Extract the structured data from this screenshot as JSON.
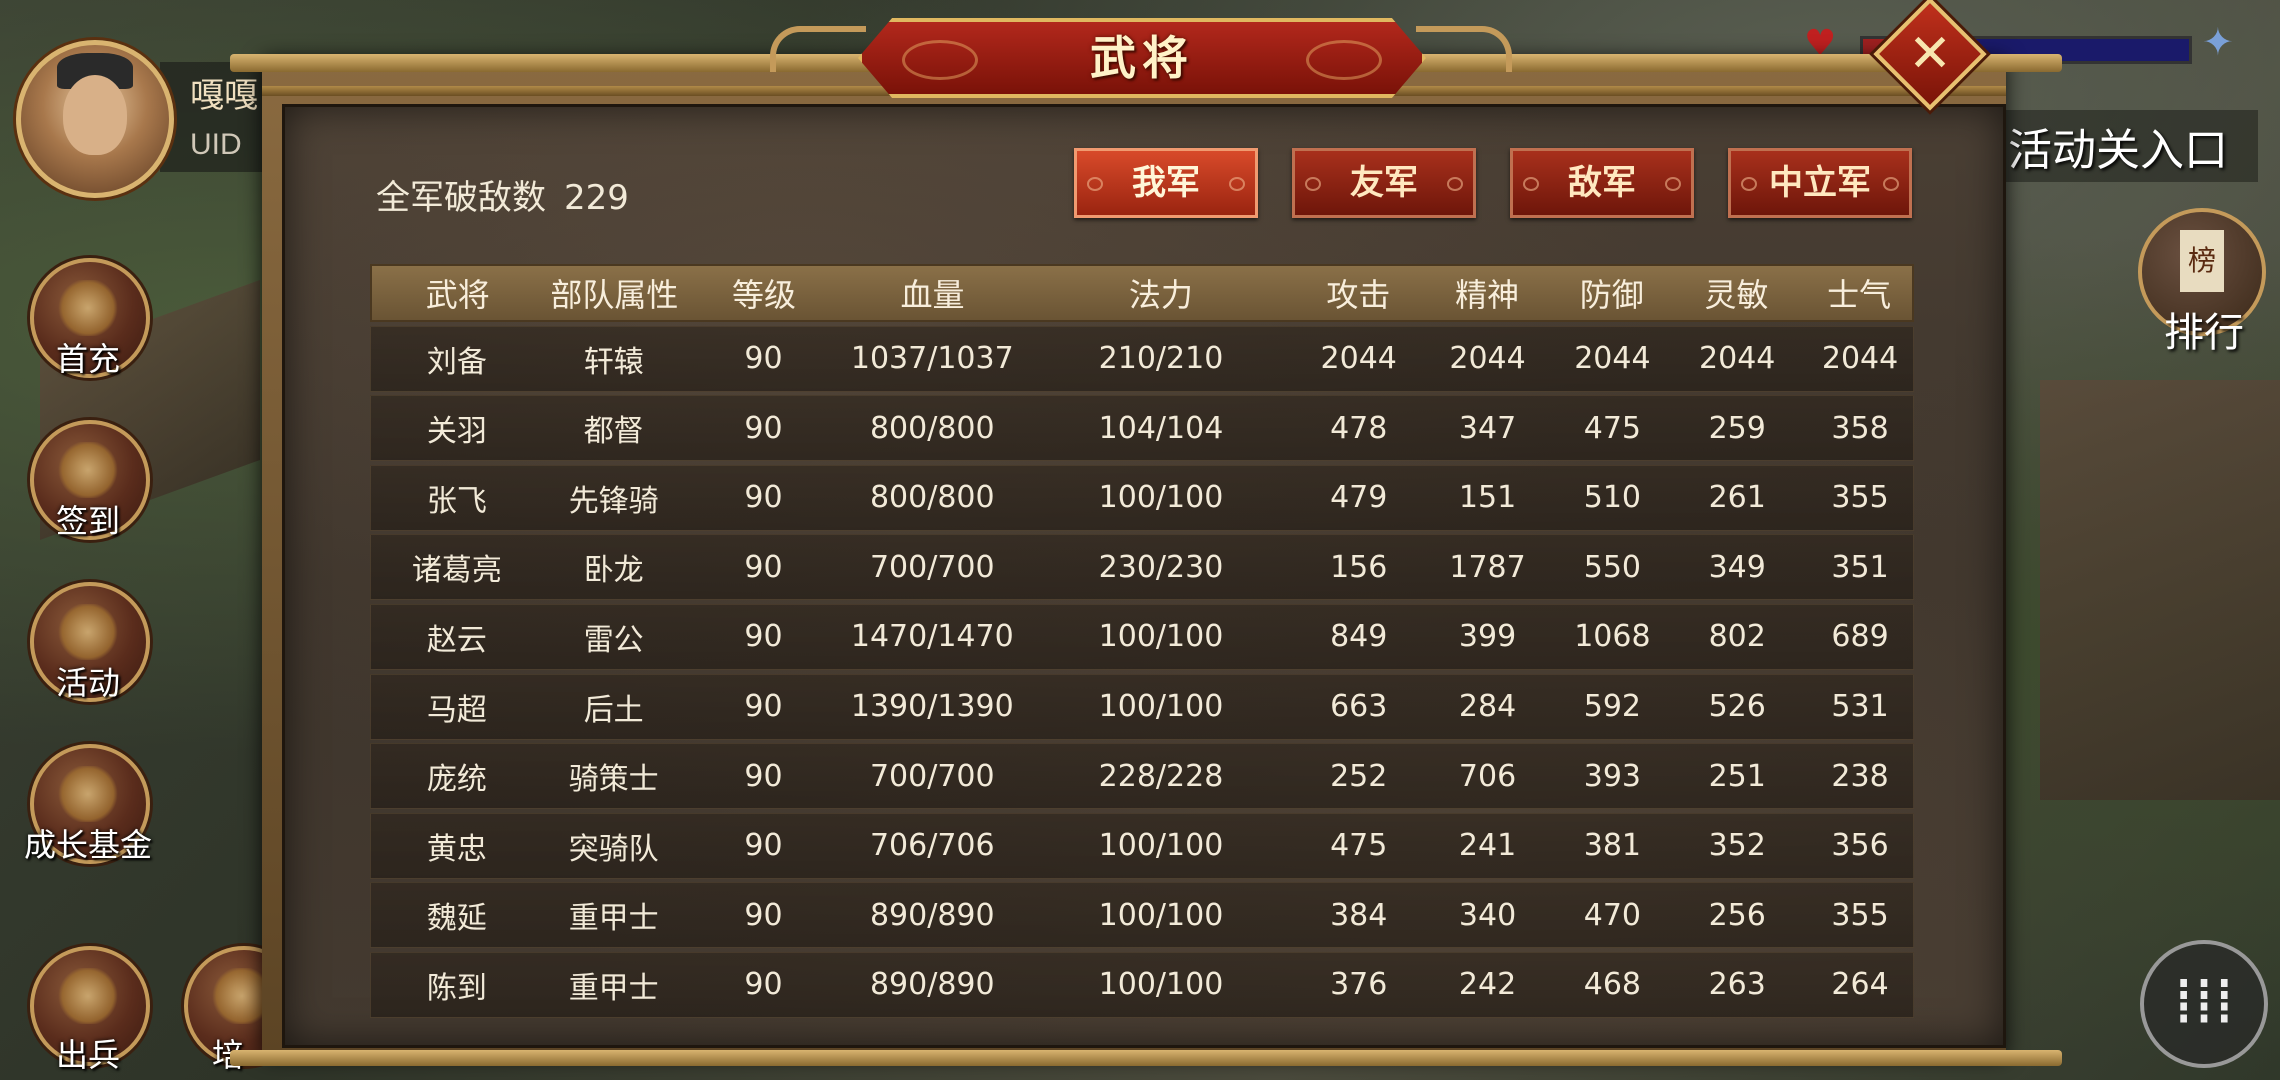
{
  "title": "武将",
  "close_label": "✕",
  "user": {
    "name": "嘎嘎",
    "uid_label": "UID"
  },
  "right_entry": "活动关入口",
  "rank": {
    "tag": "榜",
    "label": "排行"
  },
  "menu_label": "⁞⁞⁞",
  "side_buttons": [
    {
      "label": "首充",
      "icon": "gift-icon"
    },
    {
      "label": "签到",
      "icon": "scroll-icon"
    },
    {
      "label": "活动",
      "icon": "treasure-icon"
    },
    {
      "label": "成长基金",
      "icon": "plant-icon"
    },
    {
      "label": "出兵",
      "icon": "swords-icon"
    },
    {
      "label": "培",
      "icon": "shield-icon"
    }
  ],
  "summary": {
    "label": "全军破敌数",
    "value": "229"
  },
  "tabs": [
    "我军",
    "友军",
    "敌军",
    "中立军"
  ],
  "active_tab": "我军",
  "columns": [
    "武将",
    "部队属性",
    "等级",
    "血量",
    "法力",
    "攻击",
    "精神",
    "防御",
    "灵敏",
    "士气"
  ],
  "rows": [
    [
      "刘备",
      "轩辕",
      "90",
      "1037/1037",
      "210/210",
      "2044",
      "2044",
      "2044",
      "2044",
      "2044"
    ],
    [
      "关羽",
      "都督",
      "90",
      "800/800",
      "104/104",
      "478",
      "347",
      "475",
      "259",
      "358"
    ],
    [
      "张飞",
      "先锋骑",
      "90",
      "800/800",
      "100/100",
      "479",
      "151",
      "510",
      "261",
      "355"
    ],
    [
      "诸葛亮",
      "卧龙",
      "90",
      "700/700",
      "230/230",
      "156",
      "1787",
      "550",
      "349",
      "351"
    ],
    [
      "赵云",
      "雷公",
      "90",
      "1470/1470",
      "100/100",
      "849",
      "399",
      "1068",
      "802",
      "689"
    ],
    [
      "马超",
      "后土",
      "90",
      "1390/1390",
      "100/100",
      "663",
      "284",
      "592",
      "526",
      "531"
    ],
    [
      "庞统",
      "骑策士",
      "90",
      "700/700",
      "228/228",
      "252",
      "706",
      "393",
      "251",
      "238"
    ],
    [
      "黄忠",
      "突骑队",
      "90",
      "706/706",
      "100/100",
      "475",
      "241",
      "381",
      "352",
      "356"
    ],
    [
      "魏延",
      "重甲士",
      "90",
      "890/890",
      "100/100",
      "384",
      "340",
      "470",
      "256",
      "355"
    ],
    [
      "陈到",
      "重甲士",
      "90",
      "890/890",
      "100/100",
      "376",
      "242",
      "468",
      "263",
      "264"
    ]
  ],
  "colors": {
    "tab_active": "#d84a2a",
    "tab": "#a8301c",
    "banner": "#b2281c",
    "header": "#8a7048"
  }
}
